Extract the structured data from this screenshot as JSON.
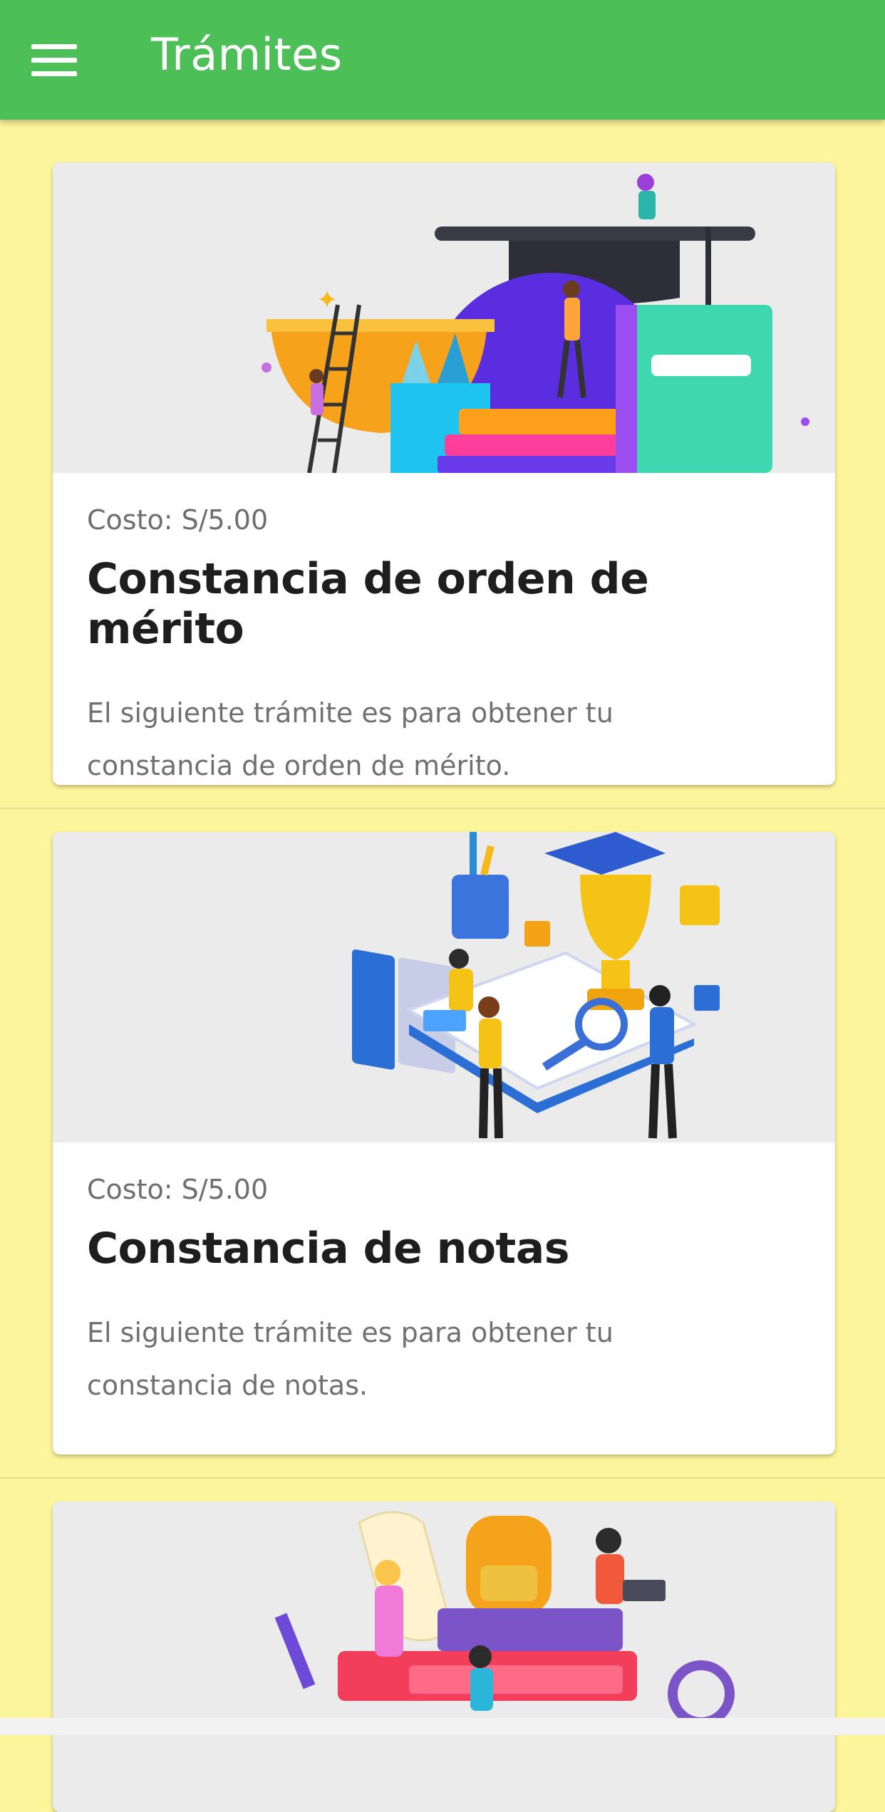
{
  "app": {
    "title": "Trámites",
    "menu_icon": "hamburger-menu-icon"
  },
  "cards": [
    {
      "cost": "Costo: S/5.00",
      "title": "Constancia de orden de mérito",
      "description_line1": "El siguiente trámite es para obtener tu",
      "description_line2": "constancia de orden de mérito.",
      "image": "graduation-illustration"
    },
    {
      "cost": "Costo: S/5.00",
      "title": "Constancia de notas",
      "description_line1": "El siguiente trámite es para obtener tu",
      "description_line2": "constancia de notas.",
      "image": "students-trophy-illustration"
    },
    {
      "image": "students-books-illustration"
    }
  ],
  "colors": {
    "appbar": "#4cbf57",
    "background": "#fdf59c",
    "card": "#ffffff",
    "media_bg": "#ebebeb"
  }
}
